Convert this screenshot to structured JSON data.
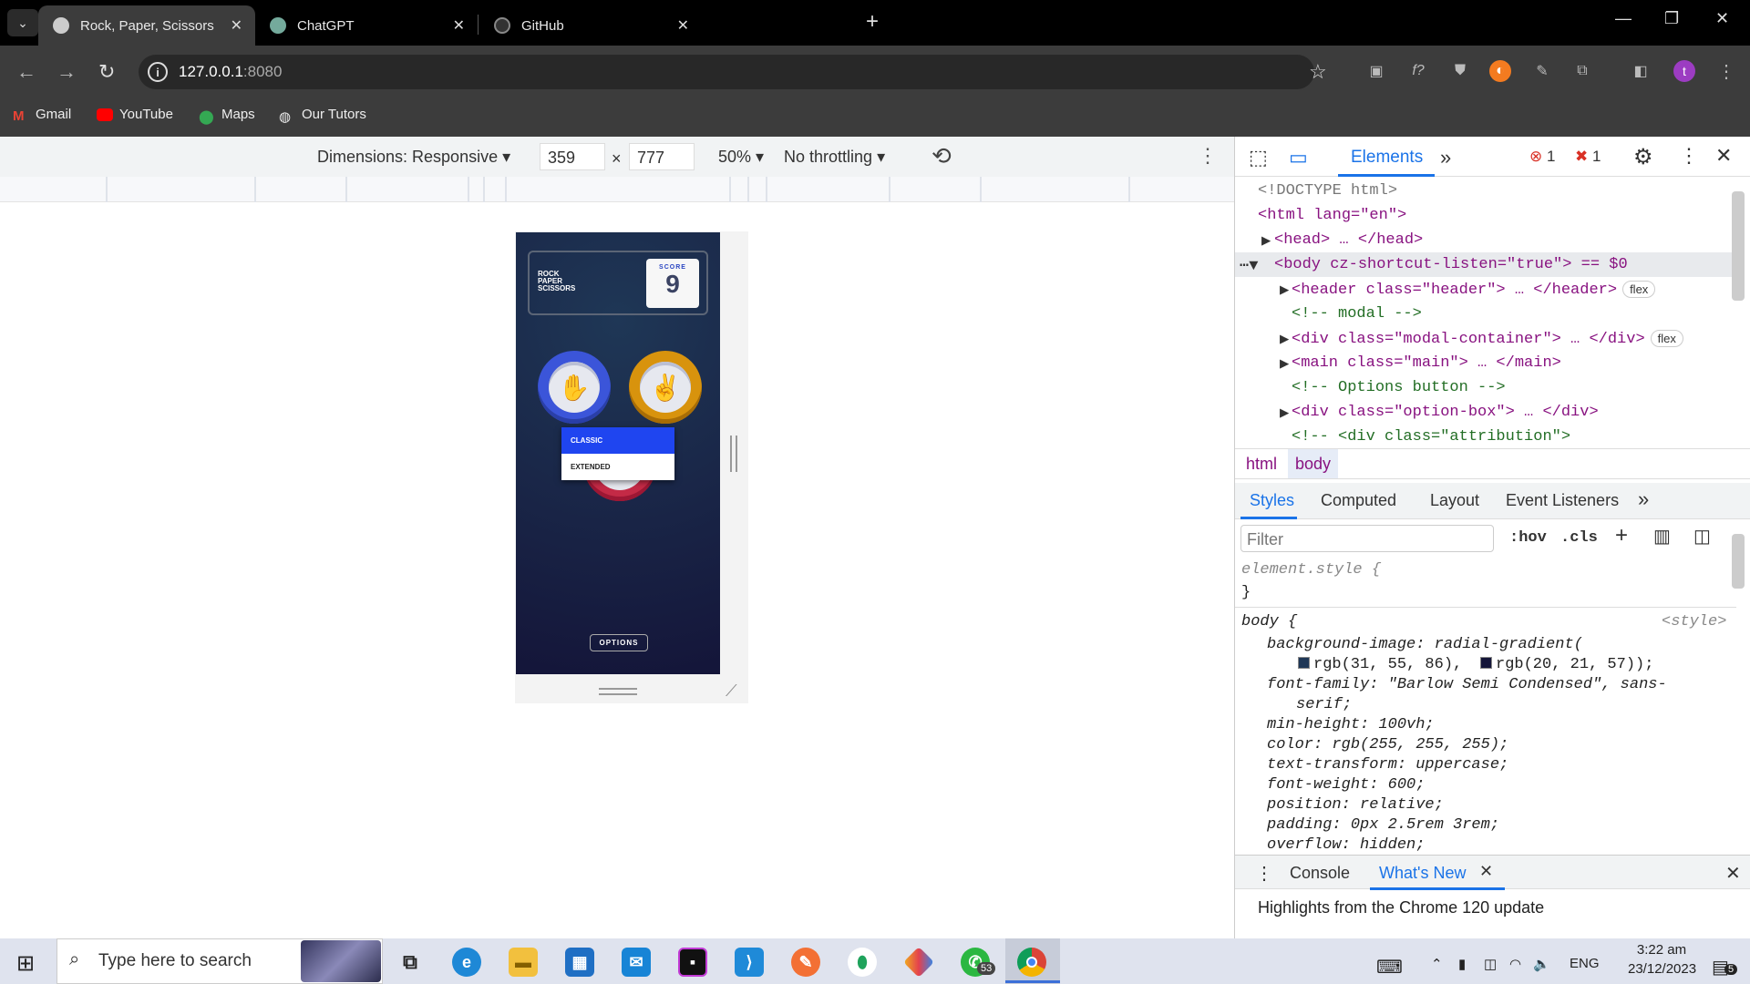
{
  "browser": {
    "tabs": [
      {
        "title": "Rock, Paper, Scissors",
        "active": true
      },
      {
        "title": "ChatGPT",
        "active": false
      },
      {
        "title": "GitHub",
        "active": false
      }
    ],
    "url_host": "127.0.0.1",
    "url_port": ":8080",
    "bookmarks": [
      "Gmail",
      "YouTube",
      "Maps",
      "Our Tutors"
    ],
    "profile_initial": "t"
  },
  "device_toolbar": {
    "dimensions_label": "Dimensions: Responsive",
    "width": "359",
    "times": "×",
    "height": "777",
    "zoom": "50%",
    "throttling": "No throttling"
  },
  "game": {
    "title_lines": [
      "ROCK",
      "PAPER",
      "SCISSORS"
    ],
    "score_label": "SCORE",
    "score_value": "9",
    "menu_options": [
      "CLASSIC",
      "EXTENDED"
    ],
    "options_button": "OPTIONS",
    "colors": {
      "paper": "#4865f4",
      "scissors": "#ec9e0e",
      "rock": "#dc2e4e",
      "menu_selected": "#1f45f0"
    }
  },
  "devtools": {
    "tab_elements": "Elements",
    "errors_count": "1",
    "issues_count": "1",
    "dom_lines": [
      "<!DOCTYPE html>",
      "<html lang=\"en\">",
      "<head> … </head>",
      "<body cz-shortcut-listen=\"true\"> == $0",
      "<header class=\"header\"> … </header>",
      "<!-- modal -->",
      "<div class=\"modal-container\"> … </div>",
      "<main class=\"main\"> … </main>",
      "<!-- Options button -->",
      "<div class=\"option-box\"> … </div>",
      "<!-- <div class=\"attribution\">"
    ],
    "pill_flex": "flex",
    "crumbs": [
      "html",
      "body"
    ],
    "style_tabs": [
      "Styles",
      "Computed",
      "Layout",
      "Event Listeners"
    ],
    "filter_placeholder": "Filter",
    "hov": ":hov",
    "cls": ".cls",
    "css_lines": [
      "element.style {",
      "}",
      "body {",
      "<style>",
      "background-image: radial-gradient(",
      "rgb(31, 55, 86),",
      "rgb(20, 21, 57));",
      "font-family: \"Barlow Semi Condensed\", sans-",
      "serif;",
      "min-height: 100vh;",
      "color: rgb(255, 255, 255);",
      "text-transform: uppercase;",
      "font-weight: 600;",
      "position: relative;",
      "padding: 0px 2.5rem 3rem;",
      "overflow: hidden;"
    ],
    "drawer_tabs": [
      "Console",
      "What's New"
    ],
    "drawer_message": "Highlights from the Chrome 120 update"
  },
  "taskbar": {
    "search_placeholder": "Type here to search",
    "whatsapp_badge": "53",
    "lang": "ENG",
    "time": "3:22 am",
    "date": "23/12/2023",
    "notifications": "5"
  }
}
